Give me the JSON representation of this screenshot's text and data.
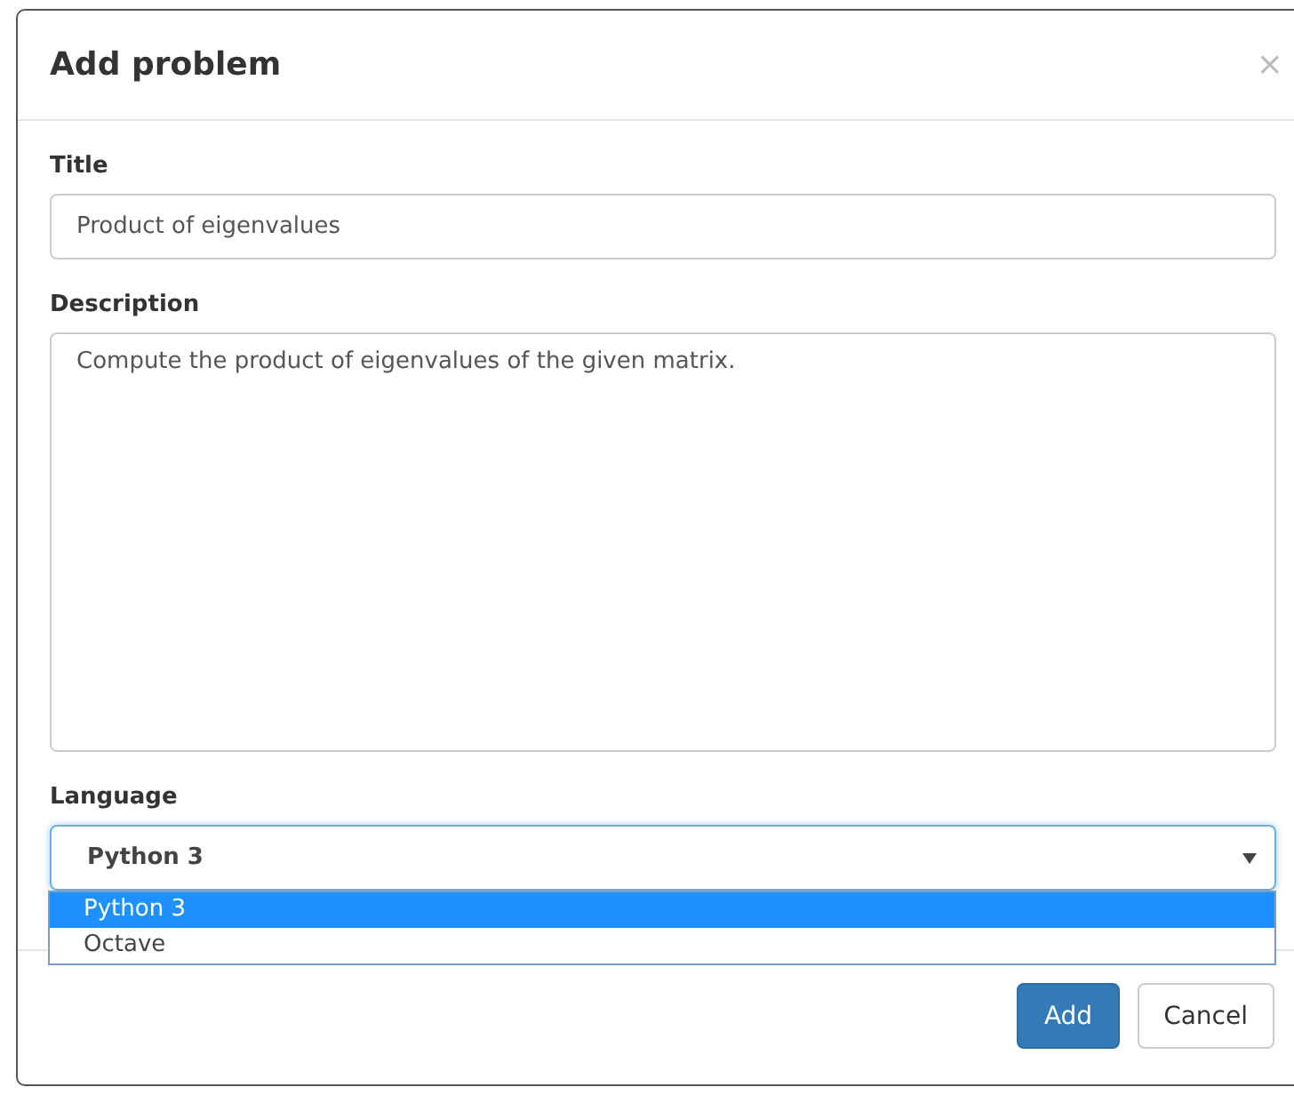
{
  "dialog": {
    "title": "Add problem",
    "close": "×"
  },
  "fields": [
    {
      "label": "Title",
      "value": "Product of eigenvalues"
    },
    {
      "label": "Description",
      "value": "Compute the product of eigenvalues of the given matrix."
    }
  ],
  "language": {
    "label": "Language",
    "value": "Python 3",
    "expanded": true,
    "options": [
      {
        "label": "Python 3",
        "selected": true
      },
      {
        "label": "Octave",
        "selected": false
      }
    ]
  },
  "buttons": [
    {
      "label": "Add",
      "kind": "primary"
    },
    {
      "label": "Cancel",
      "kind": "default"
    }
  ]
}
